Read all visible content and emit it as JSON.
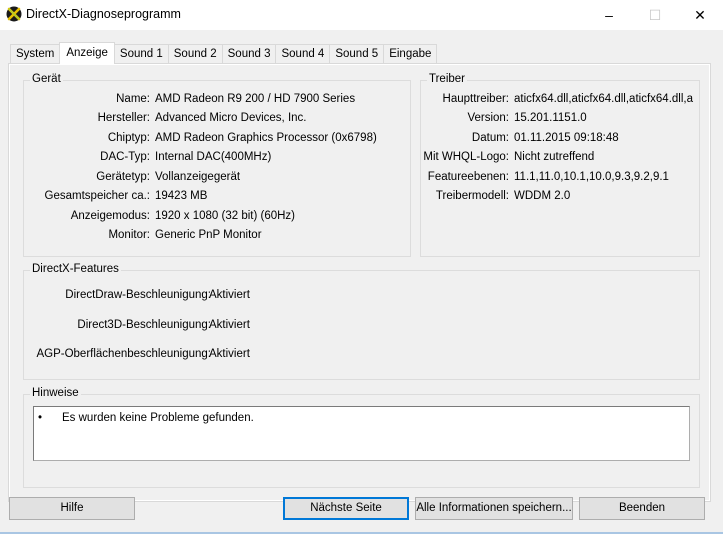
{
  "window": {
    "title": "DirectX-Diagnoseprogramm",
    "controls": {
      "minimize": "–",
      "maximize": "☐",
      "close": "✕"
    }
  },
  "tabs": [
    {
      "label": "System"
    },
    {
      "label": "Anzeige"
    },
    {
      "label": "Sound 1"
    },
    {
      "label": "Sound 2"
    },
    {
      "label": "Sound 3"
    },
    {
      "label": "Sound 4"
    },
    {
      "label": "Sound 5"
    },
    {
      "label": "Eingabe"
    }
  ],
  "geraet": {
    "title": "Gerät",
    "rows": [
      {
        "label": "Name:",
        "value": "AMD Radeon R9 200 / HD 7900 Series"
      },
      {
        "label": "Hersteller:",
        "value": "Advanced Micro Devices, Inc."
      },
      {
        "label": "Chiptyp:",
        "value": "AMD Radeon Graphics Processor (0x6798)"
      },
      {
        "label": "DAC-Typ:",
        "value": "Internal DAC(400MHz)"
      },
      {
        "label": "Gerätetyp:",
        "value": "Vollanzeigegerät"
      },
      {
        "label": "Gesamtspeicher ca.:",
        "value": "19423 MB"
      },
      {
        "label": "Anzeigemodus:",
        "value": "1920 x 1080 (32 bit) (60Hz)"
      },
      {
        "label": "Monitor:",
        "value": "Generic PnP Monitor"
      }
    ]
  },
  "treiber": {
    "title": "Treiber",
    "rows": [
      {
        "label": "Haupttreiber:",
        "value": "aticfx64.dll,aticfx64.dll,aticfx64.dll,a"
      },
      {
        "label": "Version:",
        "value": "15.201.1151.0"
      },
      {
        "label": "Datum:",
        "value": "01.11.2015 09:18:48"
      },
      {
        "label": "Mit WHQL-Logo:",
        "value": "Nicht zutreffend"
      },
      {
        "label": "Featureebenen:",
        "value": "11.1,11.0,10.1,10.0,9.3,9.2,9.1"
      },
      {
        "label": "Treibermodell:",
        "value": "WDDM 2.0"
      }
    ]
  },
  "features": {
    "title": "DirectX-Features",
    "rows": [
      {
        "label": "DirectDraw-Beschleunigung:",
        "value": "Aktiviert"
      },
      {
        "label": "Direct3D-Beschleunigung:",
        "value": "Aktiviert"
      },
      {
        "label": "AGP-Oberflächenbeschleunigung:",
        "value": "Aktiviert"
      }
    ]
  },
  "hinweise": {
    "title": "Hinweise",
    "bullet": "•",
    "text": "Es wurden keine Probleme gefunden."
  },
  "buttons": {
    "help": "Hilfe",
    "next": "Nächste Seite",
    "save_all": "Alle Informationen speichern...",
    "exit": "Beenden"
  }
}
